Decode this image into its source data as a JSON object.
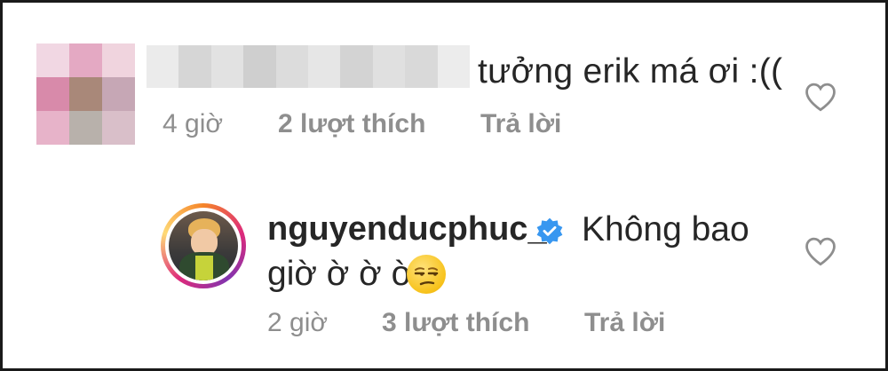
{
  "comment": {
    "text": "tưởng erik má ơi :((",
    "time": "4 giờ",
    "likes": "2 lượt thích",
    "reply_label": "Trả lời",
    "like_icon": "heart-outline-icon"
  },
  "reply": {
    "username": "nguyenducphuc_",
    "verified_icon": "verified-badge-icon",
    "text_line1": "Không bao",
    "text_line2": "giờ ờ ờ ờ",
    "emoji": "unamused-face-emoji",
    "time": "2 giờ",
    "likes": "3 lượt thích",
    "reply_label": "Trả lời",
    "like_icon": "heart-outline-icon"
  },
  "colors": {
    "text": "#262626",
    "meta": "#8e8e8e",
    "verified": "#3897f0"
  }
}
